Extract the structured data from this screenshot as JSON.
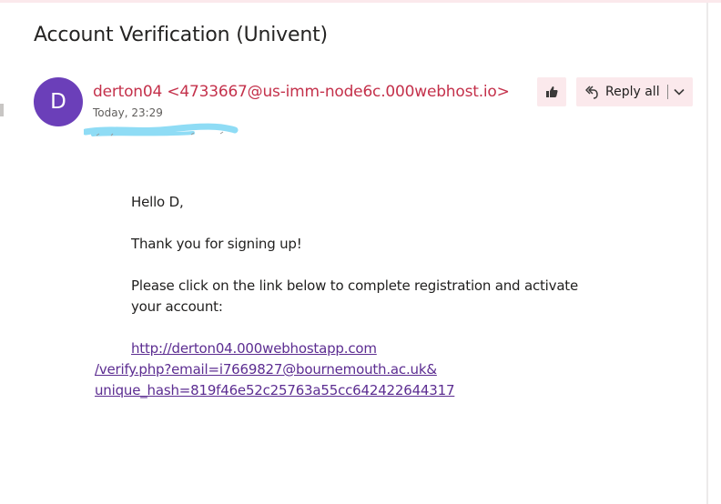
{
  "email": {
    "subject": "Account Verification (Univent)",
    "avatar_initial": "D",
    "sender": "derton04 <4733667@us-imm-node6c.000webhost.io>",
    "sent_time": "Today, 23:29",
    "actions": {
      "like_icon": "thumbs-up-icon",
      "reply_all_label": "Reply all",
      "reply_icon": "reply-all-icon",
      "dropdown_icon": "chevron-down-icon"
    },
    "body": {
      "greeting": "Hello D,",
      "thanks": "Thank you for signing up!",
      "instruction_line1": "Please click on the link below to complete registration and activate",
      "instruction_line2": "your account:",
      "link_line1": "http://derton04.000webhostapp.com",
      "link_line2": "/verify.php?email=i7669827@bournemouth.ac.uk&",
      "link_line3": "unique_hash=819f46e52c25763a55cc642422644317"
    }
  },
  "colors": {
    "accent": "#c4314b",
    "avatar_bg": "#6b3fb9",
    "button_bg": "#fbe9ec",
    "link": "#5c2d91",
    "redaction": "#8fdcf5"
  }
}
